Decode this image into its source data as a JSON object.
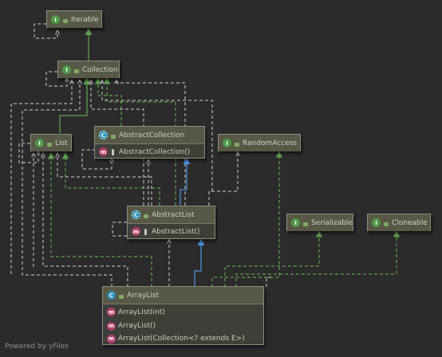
{
  "diagram": {
    "nodes": {
      "iterable": {
        "kind": "I",
        "name": "Iterable"
      },
      "collection": {
        "kind": "I",
        "name": "Collection"
      },
      "list": {
        "kind": "I",
        "name": "List"
      },
      "abstract_collection": {
        "kind": "C",
        "name": "AbstractCollection",
        "members": [
          {
            "kind": "m",
            "text": "AbstractCollection()"
          }
        ]
      },
      "random_access": {
        "kind": "I",
        "name": "RandomAccess"
      },
      "abstract_list": {
        "kind": "C",
        "name": "AbstractList",
        "members": [
          {
            "kind": "m",
            "text": "AbstractList()"
          }
        ]
      },
      "serializable": {
        "kind": "I",
        "name": "Serializable"
      },
      "cloneable": {
        "kind": "I",
        "name": "Cloneable"
      },
      "array_list": {
        "kind": "C",
        "name": "ArrayList",
        "members": [
          {
            "kind": "m",
            "text": "ArrayList(int)"
          },
          {
            "kind": "m",
            "text": "ArrayList()"
          },
          {
            "kind": "m",
            "text": "ArrayList(Collection<? extends E>)"
          }
        ]
      }
    },
    "edges": [
      {
        "from": "Collection",
        "to": "Iterable",
        "type": "extends"
      },
      {
        "from": "List",
        "to": "Collection",
        "type": "extends"
      },
      {
        "from": "AbstractCollection",
        "to": "Collection",
        "type": "implements"
      },
      {
        "from": "AbstractList",
        "to": "AbstractCollection",
        "type": "extends"
      },
      {
        "from": "AbstractList",
        "to": "List",
        "type": "implements"
      },
      {
        "from": "ArrayList",
        "to": "AbstractList",
        "type": "extends"
      },
      {
        "from": "ArrayList",
        "to": "List",
        "type": "implements"
      },
      {
        "from": "ArrayList",
        "to": "RandomAccess",
        "type": "implements"
      },
      {
        "from": "ArrayList",
        "to": "Serializable",
        "type": "implements"
      },
      {
        "from": "ArrayList",
        "to": "Cloneable",
        "type": "implements"
      }
    ],
    "colors": {
      "interface_extends": "#5fa04e",
      "class_extends": "#4b8fdc",
      "dependency": "#d0d0d0",
      "background": "#2b2b2b"
    }
  },
  "footer": {
    "text": "Powered by yFiles"
  }
}
